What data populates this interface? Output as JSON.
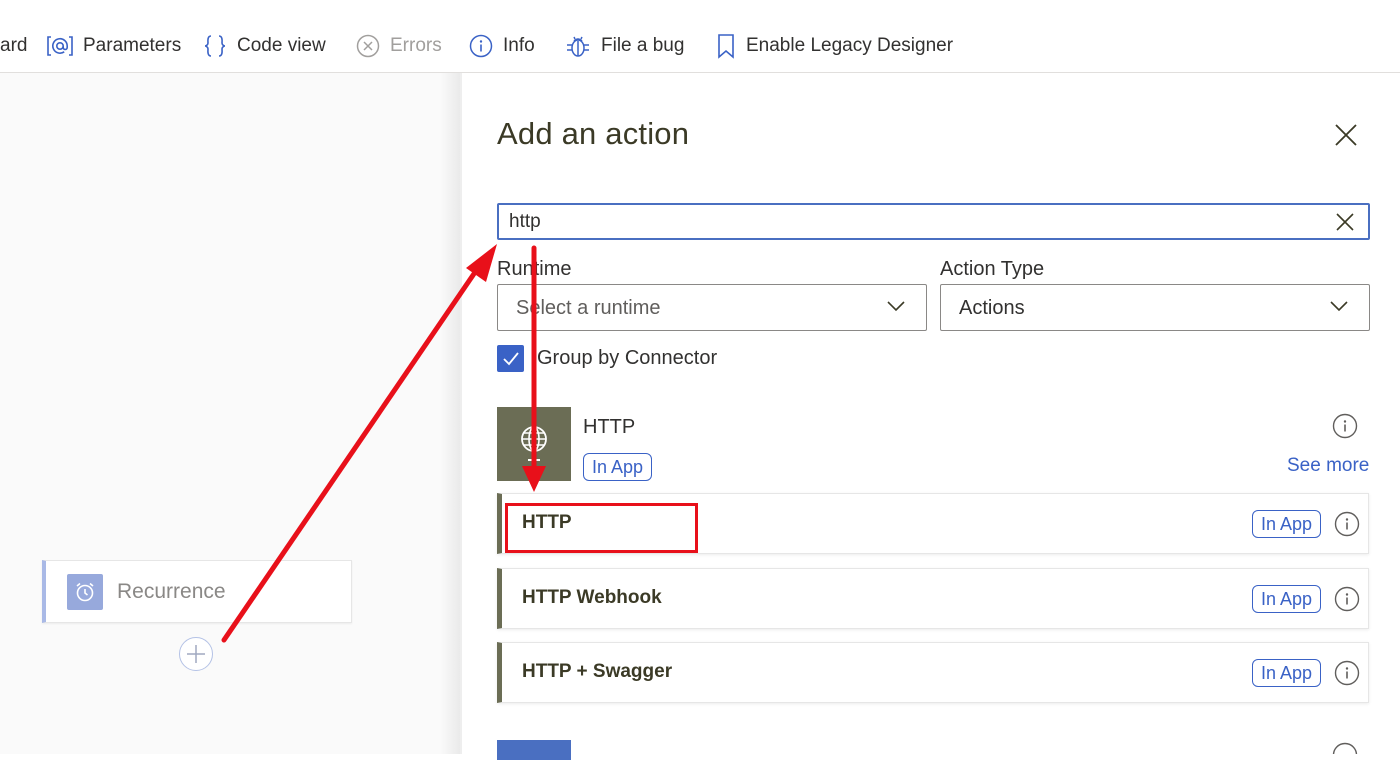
{
  "toolbar": {
    "items": [
      {
        "label": "ard"
      },
      {
        "label": "Parameters",
        "icon": "at-icon"
      },
      {
        "label": "Code view",
        "icon": "braces-icon"
      },
      {
        "label": "Errors",
        "icon": "error-circle-icon"
      },
      {
        "label": "Info",
        "icon": "info-icon"
      },
      {
        "label": "File a bug",
        "icon": "bug-icon"
      },
      {
        "label": "Enable Legacy Designer",
        "icon": "bookmark-icon"
      }
    ]
  },
  "canvas": {
    "trigger_label": "Recurrence",
    "trigger_icon": "alarm-clock-icon"
  },
  "panel": {
    "title": "Add an action",
    "search": {
      "value": "http"
    },
    "runtime": {
      "label": "Runtime",
      "placeholder": "Select a runtime"
    },
    "action_type": {
      "label": "Action Type",
      "value": "Actions"
    },
    "group_by": {
      "label": "Group by Connector",
      "checked": true
    },
    "connector": {
      "name": "HTTP",
      "badge": "In App",
      "see_more": "See more",
      "icon": "globe-icon"
    },
    "actions": [
      {
        "label": "HTTP",
        "badge": "In App"
      },
      {
        "label": "HTTP Webhook",
        "badge": "In App"
      },
      {
        "label": "HTTP + Swagger",
        "badge": "In App"
      }
    ]
  },
  "colors": {
    "accent": "#3a62c6",
    "connector": "#6b6d55",
    "annotation": "#e8101a"
  }
}
